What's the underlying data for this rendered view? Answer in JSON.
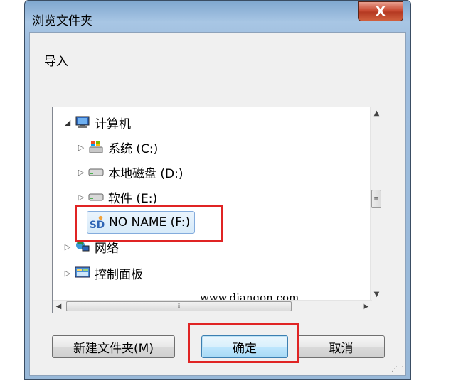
{
  "window": {
    "title": "浏览文件夹",
    "close_label": "X",
    "description": "导入"
  },
  "tree": {
    "items": [
      {
        "label": "计算机",
        "icon": "computer-icon"
      },
      {
        "label": "系统 (C:)",
        "icon": "system-drive-icon"
      },
      {
        "label": "本地磁盘 (D:)",
        "icon": "hard-drive-icon"
      },
      {
        "label": "软件 (E:)",
        "icon": "hard-drive-icon"
      },
      {
        "label": "NO NAME (F:)",
        "icon": "sd-card-icon",
        "selected": true
      },
      {
        "label": "网络",
        "icon": "network-icon"
      },
      {
        "label": "控制面板",
        "icon": "control-panel-icon"
      }
    ]
  },
  "watermark": "www.diangon.com",
  "buttons": {
    "new_folder": "新建文件夹(M)",
    "ok": "确定",
    "cancel": "取消"
  },
  "colors": {
    "highlight_box": "#e02424",
    "selection_border": "#84acdd"
  }
}
